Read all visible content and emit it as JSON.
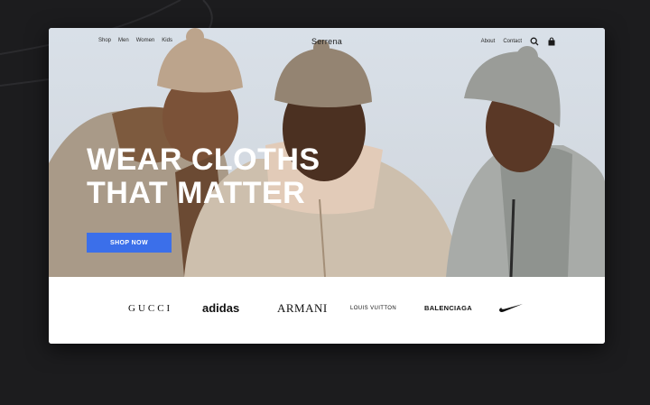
{
  "nav": {
    "links_left": [
      "Shop",
      "Men",
      "Women",
      "Kids"
    ],
    "brand": "Serrena",
    "links_right": [
      "About",
      "Contact"
    ],
    "icons": [
      "search-icon",
      "shopping-bag-icon"
    ]
  },
  "hero": {
    "headline_line1": "WEAR CLOTHS",
    "headline_line2": "THAT MATTER",
    "cta_label": "SHOP NOW"
  },
  "brands": {
    "gucci": "GUCCI",
    "adidas": "adidas",
    "armani": "ARMANI",
    "louis_vuitton": "LOUIS VUITTON",
    "balenciaga": "BALENCIAGA",
    "nike": "nike-swoosh-logo"
  },
  "colors": {
    "accent": "#3b6fea",
    "page_bg": "#1c1c1e",
    "sky": "#dde3ea"
  }
}
